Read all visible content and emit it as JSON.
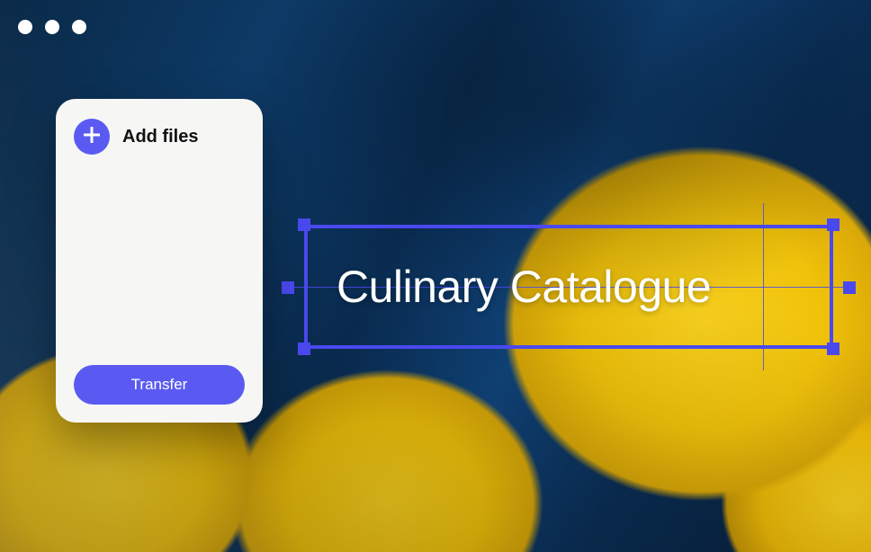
{
  "upload_card": {
    "add_files_label": "Add files",
    "transfer_label": "Transfer"
  },
  "canvas": {
    "title_text": "Culinary Catalogue"
  },
  "colors": {
    "accent": "#5a5af2",
    "selection": "#4a49ef"
  }
}
